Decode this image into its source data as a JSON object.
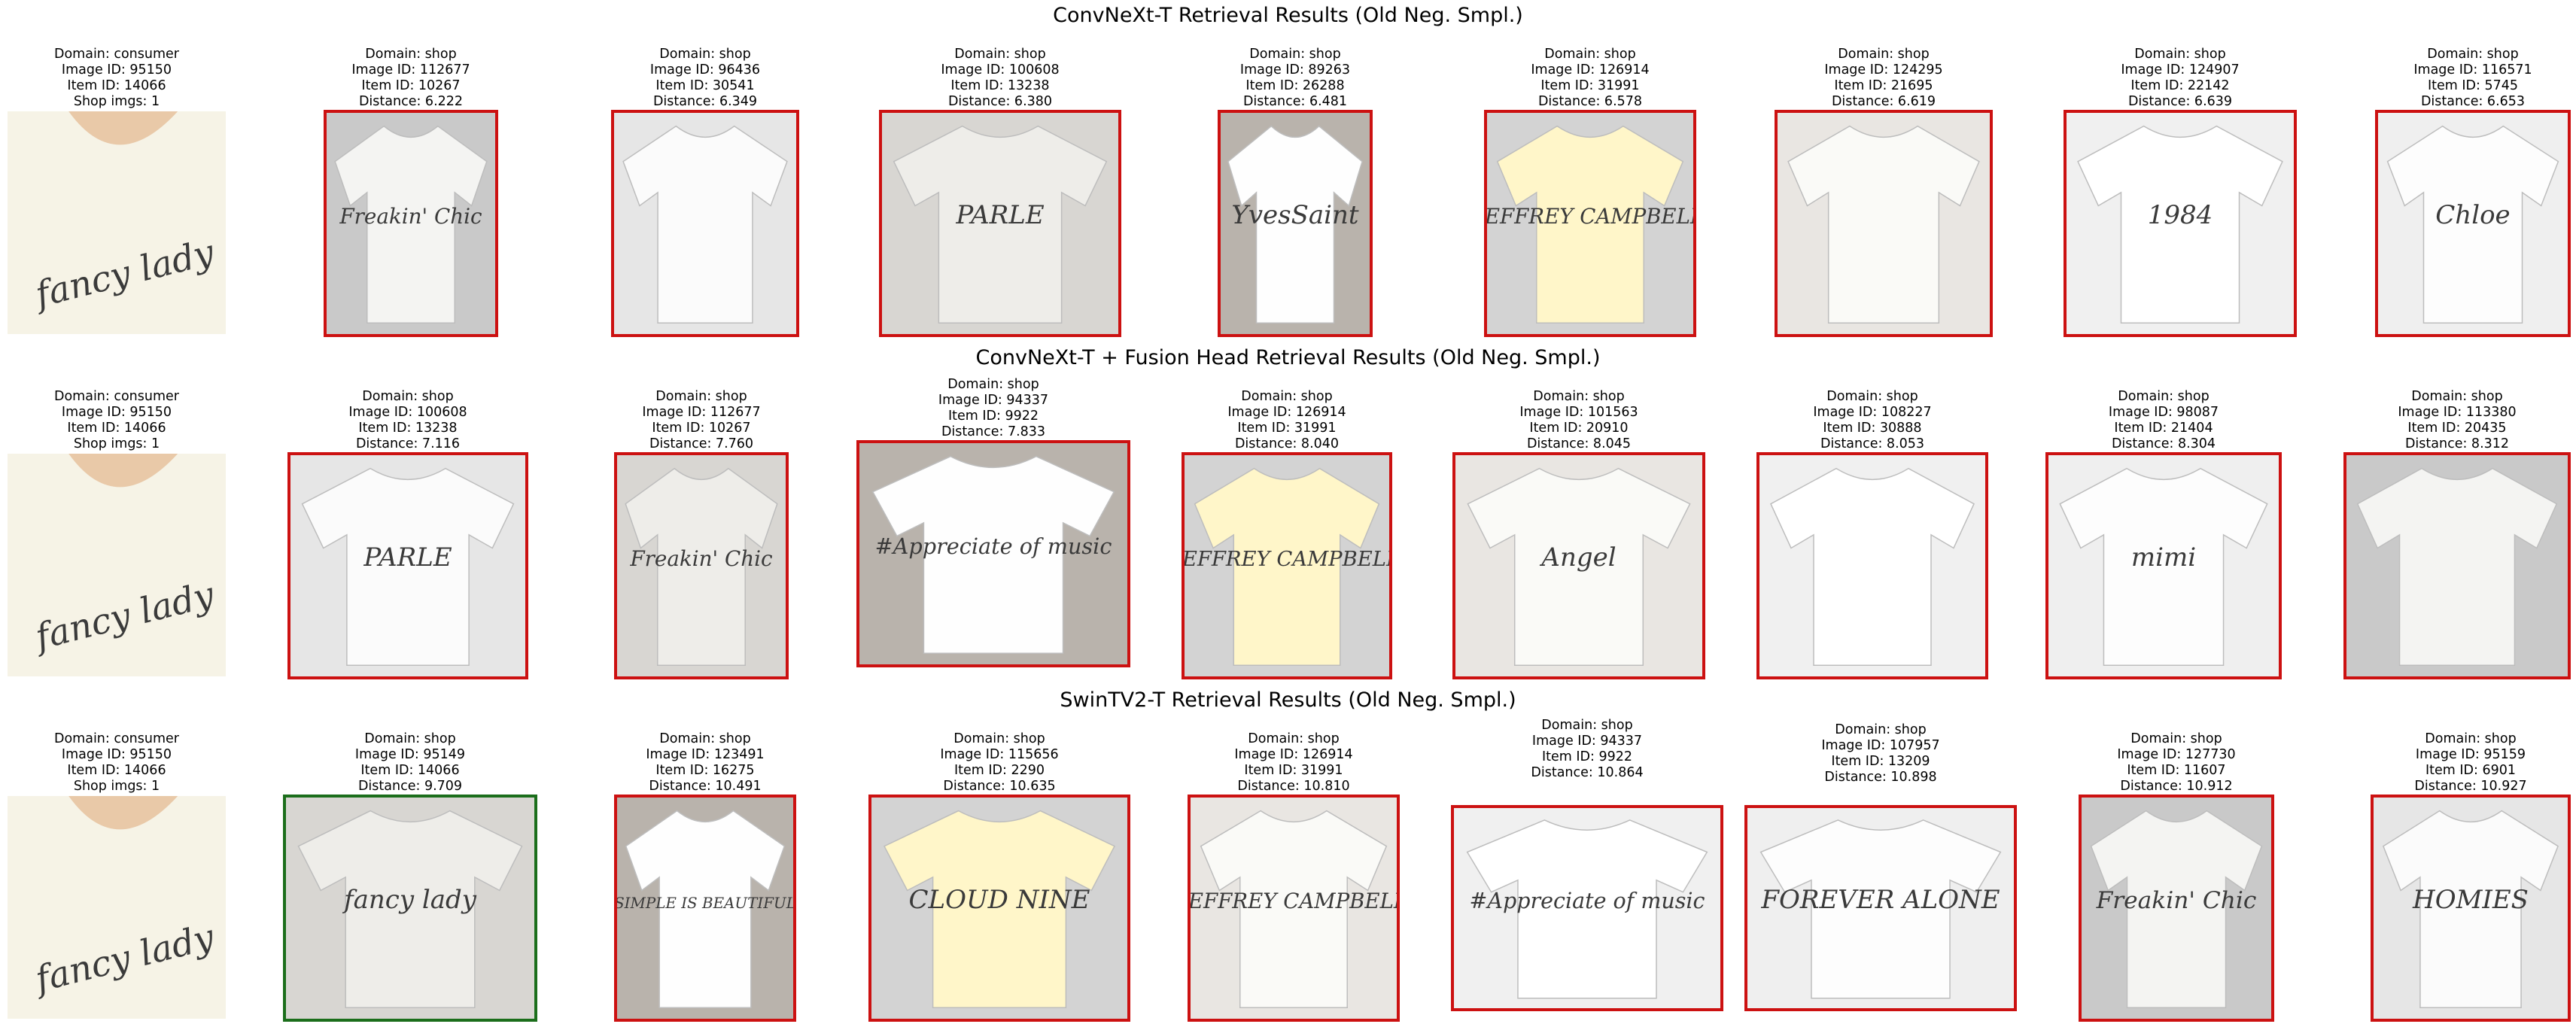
{
  "rows": [
    {
      "title": "ConvNeXt-T Retrieval Results (Old Neg. Smpl.)",
      "query": {
        "domain": "Domain: consumer",
        "image_id": "Image ID: 95150",
        "item_id": "Item ID: 14066",
        "extra": "Shop imgs: 1",
        "print": "fancy lady"
      },
      "results": [
        {
          "domain": "Domain: shop",
          "image_id": "Image ID: 112677",
          "item_id": "Item ID: 10267",
          "distance": "Distance: 6.222",
          "match": false,
          "print": "Freakin' Chic"
        },
        {
          "domain": "Domain: shop",
          "image_id": "Image ID: 96436",
          "item_id": "Item ID: 30541",
          "distance": "Distance: 6.349",
          "match": false,
          "print": ""
        },
        {
          "domain": "Domain: shop",
          "image_id": "Image ID: 100608",
          "item_id": "Item ID: 13238",
          "distance": "Distance: 6.380",
          "match": false,
          "print": "PARLE"
        },
        {
          "domain": "Domain: shop",
          "image_id": "Image ID: 89263",
          "item_id": "Item ID: 26288",
          "distance": "Distance: 6.481",
          "match": false,
          "print": "YvesSaint"
        },
        {
          "domain": "Domain: shop",
          "image_id": "Image ID: 126914",
          "item_id": "Item ID: 31991",
          "distance": "Distance: 6.578",
          "match": false,
          "print": "JEFFREY CAMPBELL"
        },
        {
          "domain": "Domain: shop",
          "image_id": "Image ID: 124295",
          "item_id": "Item ID: 21695",
          "distance": "Distance: 6.619",
          "match": false,
          "print": ""
        },
        {
          "domain": "Domain: shop",
          "image_id": "Image ID: 124907",
          "item_id": "Item ID: 22142",
          "distance": "Distance: 6.639",
          "match": false,
          "print": "1984"
        },
        {
          "domain": "Domain: shop",
          "image_id": "Image ID: 116571",
          "item_id": "Item ID: 5745",
          "distance": "Distance: 6.653",
          "match": false,
          "print": "Chloe"
        }
      ]
    },
    {
      "title": "ConvNeXt-T + Fusion Head Retrieval Results (Old Neg. Smpl.)",
      "query": {
        "domain": "Domain: consumer",
        "image_id": "Image ID: 95150",
        "item_id": "Item ID: 14066",
        "extra": "Shop imgs: 1",
        "print": "fancy lady"
      },
      "results": [
        {
          "domain": "Domain: shop",
          "image_id": "Image ID: 100608",
          "item_id": "Item ID: 13238",
          "distance": "Distance: 7.116",
          "match": false,
          "print": "PARLE"
        },
        {
          "domain": "Domain: shop",
          "image_id": "Image ID: 112677",
          "item_id": "Item ID: 10267",
          "distance": "Distance: 7.760",
          "match": false,
          "print": "Freakin' Chic"
        },
        {
          "domain": "Domain: shop",
          "image_id": "Image ID: 94337",
          "item_id": "Item ID: 9922",
          "distance": "Distance: 7.833",
          "match": false,
          "print": "#Appreciate of music"
        },
        {
          "domain": "Domain: shop",
          "image_id": "Image ID: 126914",
          "item_id": "Item ID: 31991",
          "distance": "Distance: 8.040",
          "match": false,
          "print": "JEFFREY CAMPBELL"
        },
        {
          "domain": "Domain: shop",
          "image_id": "Image ID: 101563",
          "item_id": "Item ID: 20910",
          "distance": "Distance: 8.045",
          "match": false,
          "print": "Angel"
        },
        {
          "domain": "Domain: shop",
          "image_id": "Image ID: 108227",
          "item_id": "Item ID: 30888",
          "distance": "Distance: 8.053",
          "match": false,
          "print": ""
        },
        {
          "domain": "Domain: shop",
          "image_id": "Image ID: 98087",
          "item_id": "Item ID: 21404",
          "distance": "Distance: 8.304",
          "match": false,
          "print": "mimi"
        },
        {
          "domain": "Domain: shop",
          "image_id": "Image ID: 113380",
          "item_id": "Item ID: 20435",
          "distance": "Distance: 8.312",
          "match": false,
          "print": ""
        }
      ]
    },
    {
      "title": "SwinTV2-T Retrieval Results (Old Neg. Smpl.)",
      "query": {
        "domain": "Domain: consumer",
        "image_id": "Image ID: 95150",
        "item_id": "Item ID: 14066",
        "extra": "Shop imgs: 1",
        "print": "fancy lady"
      },
      "results": [
        {
          "domain": "Domain: shop",
          "image_id": "Image ID: 95149",
          "item_id": "Item ID: 14066",
          "distance": "Distance: 9.709",
          "match": true,
          "print": "fancy lady"
        },
        {
          "domain": "Domain: shop",
          "image_id": "Image ID: 123491",
          "item_id": "Item ID: 16275",
          "distance": "Distance: 10.491",
          "match": false,
          "print": "SIMPLE IS BEAUTIFUL"
        },
        {
          "domain": "Domain: shop",
          "image_id": "Image ID: 115656",
          "item_id": "Item ID: 2290",
          "distance": "Distance: 10.635",
          "match": false,
          "print": "CLOUD NINE"
        },
        {
          "domain": "Domain: shop",
          "image_id": "Image ID: 126914",
          "item_id": "Item ID: 31991",
          "distance": "Distance: 10.810",
          "match": false,
          "print": "JEFFREY CAMPBELL"
        },
        {
          "domain": "Domain: shop",
          "image_id": "Image ID: 94337",
          "item_id": "Item ID: 9922",
          "distance": "Distance: 10.864",
          "match": false,
          "print": "#Appreciate of music"
        },
        {
          "domain": "Domain: shop",
          "image_id": "Image ID: 107957",
          "item_id": "Item ID: 13209",
          "distance": "Distance: 10.898",
          "match": false,
          "print": "FOREVER ALONE"
        },
        {
          "domain": "Domain: shop",
          "image_id": "Image ID: 127730",
          "item_id": "Item ID: 11607",
          "distance": "Distance: 10.912",
          "match": false,
          "print": "Freakin' Chic"
        },
        {
          "domain": "Domain: shop",
          "image_id": "Image ID: 95159",
          "item_id": "Item ID: 6901",
          "distance": "Distance: 10.927",
          "match": false,
          "print": "HOMIES"
        }
      ]
    }
  ],
  "colors": {
    "match_border": "#1b6e1b",
    "nonmatch_border": "#cc1111"
  }
}
